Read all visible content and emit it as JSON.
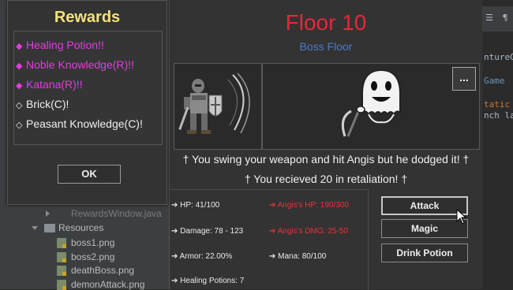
{
  "ide": {
    "code_lines": [
      {
        "text": "ntureG",
        "color": "#a9b7c6"
      },
      {
        "text": "Game",
        "color": "#6897bb"
      },
      {
        "text": "tatic",
        "color": "#cc7832"
      },
      {
        "text": "nch la",
        "color": "#a9b7c6"
      }
    ],
    "tree": {
      "rewards_window_file": "RewardsWindow.java",
      "resources_folder": "Resources",
      "files": [
        "boss1.png",
        "boss2.png",
        "deathBoss.png",
        "demonAttack.png"
      ]
    },
    "toolbar_icons": [
      "list-icon",
      "pilcrow-icon"
    ]
  },
  "rewards": {
    "title": "Rewards",
    "items": [
      {
        "label": "Healing Potion!!",
        "rarity": "rare",
        "bullet": "◆"
      },
      {
        "label": "Noble Knowledge(R)!!",
        "rarity": "rare",
        "bullet": "◆"
      },
      {
        "label": "Katana(R)!!",
        "rarity": "rare",
        "bullet": "◆"
      },
      {
        "label": "Brick(C)!",
        "rarity": "common",
        "bullet": "◇"
      },
      {
        "label": "Peasant Knowledge(C)!",
        "rarity": "common",
        "bullet": "◇"
      }
    ],
    "ok_label": "OK",
    "colors": {
      "title": "#f4e27a",
      "rare": "#e23de0",
      "common": "#eeeeee"
    }
  },
  "game": {
    "floor_title": "Floor 10",
    "floor_subtitle": "Boss Floor",
    "menu_button": "...",
    "messages": [
      "† You swing your weapon and hit Angis but he dodged it! †",
      "† You recieved 20 in retaliation! †"
    ],
    "player_stats": {
      "hp": "➔ HP: 41/100",
      "damage": "➔ Damage: 78 - 123",
      "armor": "➔ Armor: 22.00%",
      "healing_potions": "➔ Healing Potions: 7"
    },
    "enemy_stats": {
      "hp": "➔ Angis's HP: 190/300",
      "dmg": "➔ Angis's DMG: 25-50"
    },
    "mana": "➔ Mana: 80/100",
    "actions": {
      "attack": "Attack",
      "magic": "Magic",
      "drink_potion": "Drink Potion"
    },
    "colors": {
      "title": "#e8263a",
      "subtitle": "#4f79c9",
      "enemy_stat": "#e8323a"
    }
  }
}
